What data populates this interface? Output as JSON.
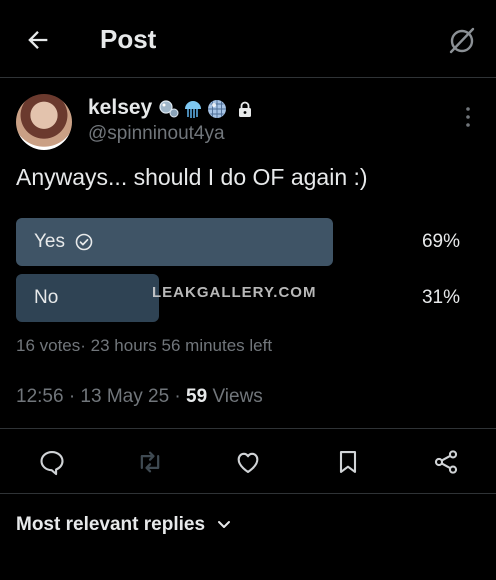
{
  "header": {
    "title": "Post"
  },
  "author": {
    "name": "kelsey",
    "handle": "@spinninout4ya",
    "badges": [
      "bubbles-emoji",
      "jellyfish-emoji",
      "disco-ball-emoji"
    ],
    "protected": true
  },
  "post": {
    "text": "Anyways... should I do OF again :)"
  },
  "poll": {
    "options": [
      {
        "label": "Yes",
        "percent": "69%",
        "fraction": 0.69,
        "selected": true
      },
      {
        "label": "No",
        "percent": "31%",
        "fraction": 0.31,
        "selected": false
      }
    ],
    "meta": "16 votes· 23 hours 56 minutes left"
  },
  "watermark": "LEAKGALLERY.COM",
  "timestamp": {
    "time": "12:56 · 13 May 25 · ",
    "views_count": "59",
    "views_label": " Views"
  },
  "actions": [
    "reply-icon",
    "repost-icon",
    "like-icon",
    "bookmark-icon",
    "share-icon"
  ],
  "replies": {
    "sort_label": "Most relevant replies"
  },
  "colors": {
    "background": "#000000",
    "text": "#e7e9ea",
    "muted": "#71767b",
    "poll_bar_selected": "#3f5466",
    "poll_bar": "#2f4354",
    "divider": "#2f3336"
  }
}
